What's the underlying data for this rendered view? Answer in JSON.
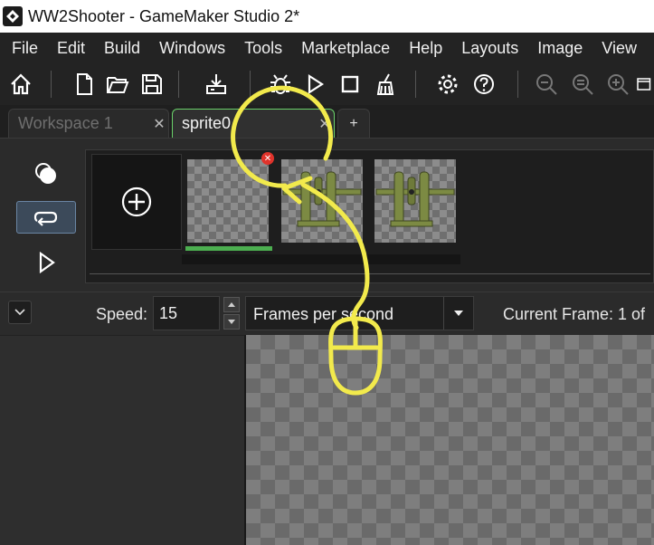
{
  "window": {
    "title": "WW2Shooter - GameMaker Studio 2*",
    "app_icon": "gamemaker-logo-icon"
  },
  "menu": [
    "File",
    "Edit",
    "Build",
    "Windows",
    "Tools",
    "Marketplace",
    "Help",
    "Layouts",
    "Image",
    "View"
  ],
  "toolbar": {
    "icons": [
      "home-icon",
      "new-file-icon",
      "open-folder-icon",
      "save-icon",
      "create-executable-icon",
      "debug-icon",
      "run-icon",
      "stop-icon",
      "clean-icon",
      "settings-icon",
      "help-icon",
      "zoom-out-icon",
      "zoom-reset-icon",
      "zoom-in-icon",
      "window-icon"
    ]
  },
  "tabs": [
    {
      "label": "Workspace 1",
      "close": "✕",
      "active": false
    },
    {
      "label": "sprite0",
      "close": "✕",
      "active": true
    }
  ],
  "new_tab": "+",
  "frames": {
    "count": 3,
    "selected_index": 0,
    "delete_badge": "✕",
    "add_icon": "add-frame-icon"
  },
  "left_tools": [
    "onion-skin-icon",
    "loop-icon",
    "play-icon"
  ],
  "playback": {
    "speed_label": "Speed:",
    "speed_value": "15",
    "units": "Frames per second",
    "current_frame": "Current Frame: 1 of"
  },
  "colors": {
    "annotation": "#f2ea4c",
    "active_tab_border": "#6ad06a",
    "selected_frame_bar": "#4caf50",
    "delete_badge": "#e0332b",
    "plane_body": "#7c8a43"
  }
}
